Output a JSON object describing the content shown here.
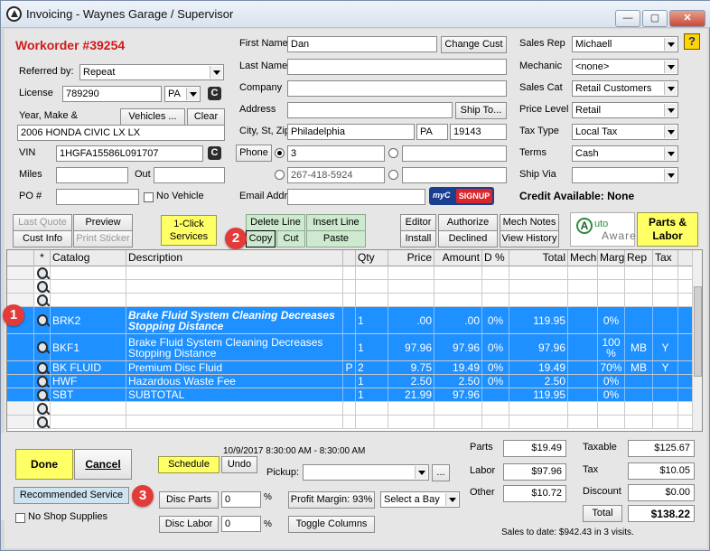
{
  "window": {
    "title": "Invoicing - Waynes Garage / Supervisor",
    "minimize": "—",
    "maximize": "▢",
    "close": "✕"
  },
  "header": {
    "workorder": "Workorder #39254",
    "referred_by_label": "Referred by:",
    "referred_by": "Repeat",
    "license_label": "License",
    "license": "789290",
    "state": "PA",
    "year_make_label": "Year, Make &",
    "vehicles_btn": "Vehicles ...",
    "clear_btn": "Clear",
    "vehicle": "2006 HONDA CIVIC LX LX",
    "vin_label": "VIN",
    "vin": "1HGFA15586L091707",
    "miles_label": "Miles",
    "out_label": "Out",
    "po_label": "PO #",
    "no_vehicle": "No Vehicle",
    "c_icon": "C"
  },
  "customer": {
    "first_name_label": "First Name",
    "first_name": "Dan",
    "change_cust": "Change Cust",
    "last_name_label": "Last Name",
    "company_label": "Company",
    "address_label": "Address",
    "ship_to": "Ship To...",
    "city_label": "City, St, Zip",
    "city": "Philadelphia",
    "st": "PA",
    "zip": "19143",
    "phone_btn": "Phone",
    "phone1": "3",
    "phone2": "267-418-5924",
    "email_label": "Email Addr",
    "signup": "SIGNUP",
    "myc": "myC"
  },
  "right_panel": {
    "sales_rep_label": "Sales Rep",
    "sales_rep": "Michaell",
    "mechanic_label": "Mechanic",
    "mechanic": "<none>",
    "sales_cat_label": "Sales Cat",
    "sales_cat": "Retail Customers",
    "price_level_label": "Price Level",
    "price_level": "Retail",
    "tax_type_label": "Tax Type",
    "tax_type": "Local Tax",
    "terms_label": "Terms",
    "terms": "Cash",
    "ship_via_label": "Ship Via",
    "credit": "Credit Available: None",
    "help": "?"
  },
  "toolbar": {
    "last_quote": "Last Quote",
    "preview": "Preview",
    "cust_info": "Cust Info",
    "print_sticker": "Print Sticker",
    "one_click": "1-Click Services",
    "delete_line": "Delete Line",
    "insert_line": "Insert Line",
    "copy": "Copy",
    "cut": "Cut",
    "paste": "Paste",
    "editor": "Editor",
    "authorize": "Authorize",
    "mech_notes": "Mech Notes",
    "install": "Install",
    "declined": "Declined",
    "view_history": "View History",
    "auto_aware_a": "A",
    "auto_aware_1": "uto",
    "auto_aware_2": "Aware",
    "parts_labor": "Parts & Labor"
  },
  "grid": {
    "columns": [
      "*",
      "Catalog",
      "Description",
      "",
      "Qty",
      "Price",
      "Amount",
      "D %",
      "Total",
      "Mech",
      "Marg",
      "Rep",
      "Tax"
    ],
    "rows": [
      {
        "catalog": "",
        "desc": "",
        "flag": "",
        "qty": "",
        "price": "",
        "amount": "",
        "d": "",
        "total": "",
        "mech": "",
        "marg": "",
        "rep": "",
        "tax": "",
        "sel": false
      },
      {
        "catalog": "",
        "desc": "",
        "flag": "",
        "qty": "",
        "price": "",
        "amount": "",
        "d": "",
        "total": "",
        "mech": "",
        "marg": "",
        "rep": "",
        "tax": "",
        "sel": false
      },
      {
        "catalog": "",
        "desc": "",
        "flag": "",
        "qty": "",
        "price": "",
        "amount": "",
        "d": "",
        "total": "",
        "mech": "",
        "marg": "",
        "rep": "",
        "tax": "",
        "sel": false
      },
      {
        "catalog": "BRK2",
        "desc": "Brake Fluid System Cleaning Decreases Stopping Distance",
        "flag": "",
        "qty": "1",
        "price": ".00",
        "amount": ".00",
        "d": "0%",
        "total": "119.95",
        "mech": "",
        "marg": "0%",
        "rep": "",
        "tax": "",
        "sel": true,
        "bold": true
      },
      {
        "catalog": "BKF1",
        "desc": "Brake Fluid System Cleaning Decreases Stopping Distance",
        "flag": "",
        "qty": "1",
        "price": "97.96",
        "amount": "97.96",
        "d": "0%",
        "total": "97.96",
        "mech": "",
        "marg": "100 %",
        "rep": "MB",
        "tax": "Y",
        "sel": true
      },
      {
        "catalog": "BK FLUID",
        "desc": "Premium Disc Fluid",
        "flag": "P",
        "qty": "2",
        "price": "9.75",
        "amount": "19.49",
        "d": "0%",
        "total": "19.49",
        "mech": "",
        "marg": "70%",
        "rep": "MB",
        "tax": "Y",
        "sel": true
      },
      {
        "catalog": "HWF",
        "desc": "Hazardous Waste Fee",
        "flag": "",
        "qty": "1",
        "price": "2.50",
        "amount": "2.50",
        "d": "0%",
        "total": "2.50",
        "mech": "",
        "marg": "0%",
        "rep": "",
        "tax": "",
        "sel": true
      },
      {
        "catalog": "SBT",
        "desc": "SUBTOTAL",
        "flag": "",
        "qty": "1",
        "price": "21.99",
        "amount": "97.96",
        "d": "",
        "total": "119.95",
        "mech": "",
        "marg": "0%",
        "rep": "",
        "tax": "",
        "sel": true
      },
      {
        "catalog": "",
        "desc": "",
        "flag": "",
        "qty": "",
        "price": "",
        "amount": "",
        "d": "",
        "total": "",
        "mech": "",
        "marg": "",
        "rep": "",
        "tax": "",
        "sel": false
      },
      {
        "catalog": "",
        "desc": "",
        "flag": "",
        "qty": "",
        "price": "",
        "amount": "",
        "d": "",
        "total": "",
        "mech": "",
        "marg": "",
        "rep": "",
        "tax": "",
        "sel": false
      }
    ]
  },
  "bottom": {
    "done": "Done",
    "cancel": "Cancel",
    "schedule": "Schedule",
    "undo": "Undo",
    "sched_time": "10/9/2017 8:30:00 AM - 8:30:00 AM",
    "pickup_label": "Pickup:",
    "ellipsis": "...",
    "recommended": "Recommended Service",
    "no_shop_supplies": "No Shop Supplies",
    "disc_parts": "Disc Parts",
    "disc_parts_val": "0",
    "disc_labor": "Disc Labor",
    "disc_labor_val": "0",
    "pct": "%",
    "profit_margin": "Profit Margin: 93%",
    "select_bay": "Select a Bay",
    "toggle_columns": "Toggle Columns",
    "parts_label": "Parts",
    "parts": "$19.49",
    "labor_label": "Labor",
    "labor": "$97.96",
    "other_label": "Other",
    "other": "$10.72",
    "taxable_label": "Taxable",
    "taxable": "$125.67",
    "tax_label": "Tax",
    "tax": "$10.05",
    "discount_label": "Discount",
    "discount": "$0.00",
    "total_btn": "Total",
    "total": "$138.22",
    "sales_to_date": "Sales to date: $942.43 in 3 visits."
  },
  "badges": {
    "one": "1",
    "two": "2",
    "three": "3"
  }
}
